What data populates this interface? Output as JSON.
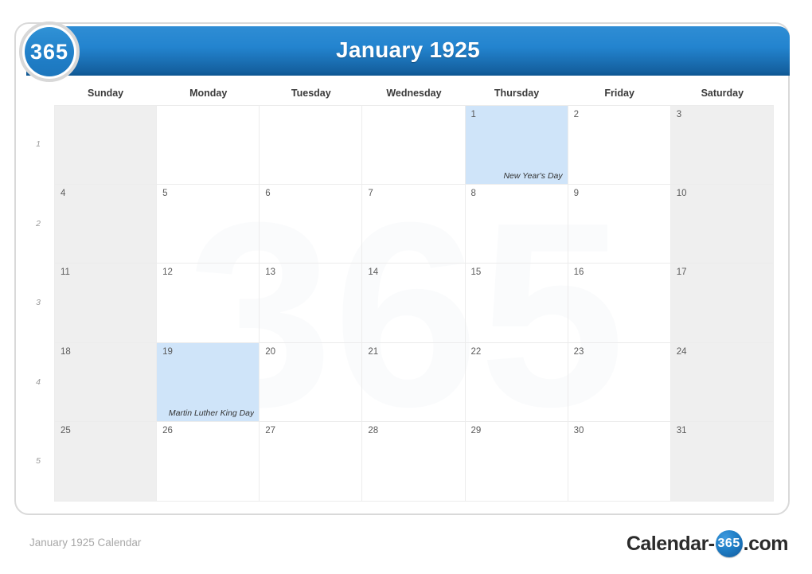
{
  "badge": {
    "label": "365"
  },
  "header": {
    "title": "January 1925"
  },
  "watermark": {
    "text": "365"
  },
  "weekdays": [
    "Sunday",
    "Monday",
    "Tuesday",
    "Wednesday",
    "Thursday",
    "Friday",
    "Saturday"
  ],
  "week_numbers": [
    "1",
    "2",
    "3",
    "4",
    "5"
  ],
  "weeks": [
    [
      {
        "day": "",
        "event": "",
        "type": "empty"
      },
      {
        "day": "",
        "event": "",
        "type": "empty-white"
      },
      {
        "day": "",
        "event": "",
        "type": "empty-white"
      },
      {
        "day": "",
        "event": "",
        "type": "empty-white"
      },
      {
        "day": "1",
        "event": "New Year's Day",
        "type": "holiday"
      },
      {
        "day": "2",
        "event": "",
        "type": "plain"
      },
      {
        "day": "3",
        "event": "",
        "type": "weekend"
      }
    ],
    [
      {
        "day": "4",
        "event": "",
        "type": "weekend"
      },
      {
        "day": "5",
        "event": "",
        "type": "plain"
      },
      {
        "day": "6",
        "event": "",
        "type": "plain"
      },
      {
        "day": "7",
        "event": "",
        "type": "plain"
      },
      {
        "day": "8",
        "event": "",
        "type": "plain"
      },
      {
        "day": "9",
        "event": "",
        "type": "plain"
      },
      {
        "day": "10",
        "event": "",
        "type": "weekend"
      }
    ],
    [
      {
        "day": "11",
        "event": "",
        "type": "weekend"
      },
      {
        "day": "12",
        "event": "",
        "type": "plain"
      },
      {
        "day": "13",
        "event": "",
        "type": "plain"
      },
      {
        "day": "14",
        "event": "",
        "type": "plain"
      },
      {
        "day": "15",
        "event": "",
        "type": "plain"
      },
      {
        "day": "16",
        "event": "",
        "type": "plain"
      },
      {
        "day": "17",
        "event": "",
        "type": "weekend"
      }
    ],
    [
      {
        "day": "18",
        "event": "",
        "type": "weekend"
      },
      {
        "day": "19",
        "event": "Martin Luther King Day",
        "type": "holiday"
      },
      {
        "day": "20",
        "event": "",
        "type": "plain"
      },
      {
        "day": "21",
        "event": "",
        "type": "plain"
      },
      {
        "day": "22",
        "event": "",
        "type": "plain"
      },
      {
        "day": "23",
        "event": "",
        "type": "plain"
      },
      {
        "day": "24",
        "event": "",
        "type": "weekend"
      }
    ],
    [
      {
        "day": "25",
        "event": "",
        "type": "weekend"
      },
      {
        "day": "26",
        "event": "",
        "type": "plain"
      },
      {
        "day": "27",
        "event": "",
        "type": "plain"
      },
      {
        "day": "28",
        "event": "",
        "type": "plain"
      },
      {
        "day": "29",
        "event": "",
        "type": "plain"
      },
      {
        "day": "30",
        "event": "",
        "type": "plain"
      },
      {
        "day": "31",
        "event": "",
        "type": "weekend"
      }
    ]
  ],
  "footer": {
    "caption": "January 1925 Calendar",
    "brand_prefix": "Calendar-",
    "brand_badge": "365",
    "brand_suffix": ".com"
  },
  "colors": {
    "header_blue": "#2384cf",
    "holiday_blue": "#cfe4f9",
    "weekend_gray": "#efefef",
    "frame_gray": "#d9d9d9"
  }
}
